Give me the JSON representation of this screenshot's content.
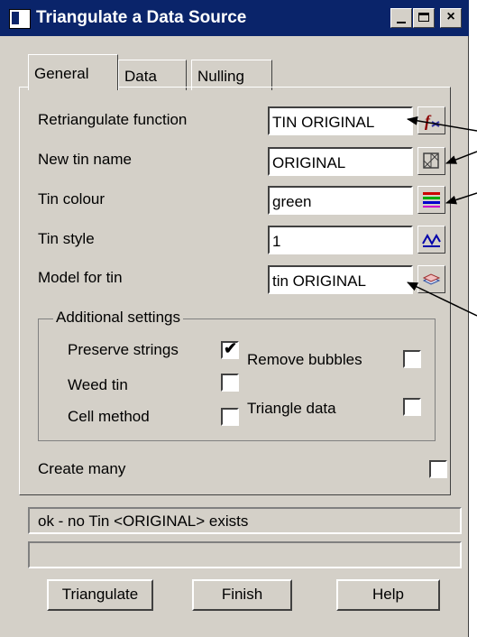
{
  "window": {
    "title": "Triangulate a Data Source"
  },
  "tabs": [
    {
      "label": "General"
    },
    {
      "label": "Data"
    },
    {
      "label": "Nulling"
    }
  ],
  "fields": {
    "retriangulate": {
      "label": "Retriangulate function",
      "value": "TIN ORIGINAL",
      "icon": "function-icon"
    },
    "tin_name": {
      "label": "New tin name",
      "value": "ORIGINAL",
      "icon": "tin-icon"
    },
    "tin_colour": {
      "label": "Tin colour",
      "value": "green",
      "icon": "colour-icon"
    },
    "tin_style": {
      "label": "Tin style",
      "value": "1",
      "icon": "style-icon"
    },
    "model": {
      "label": "Model for tin",
      "value": "tin ORIGINAL",
      "icon": "model-icon"
    }
  },
  "additional": {
    "title": "Additional settings",
    "preserve_strings": {
      "label": "Preserve strings",
      "checked": true
    },
    "remove_bubbles": {
      "label": "Remove bubbles",
      "checked": false
    },
    "weed_tin": {
      "label": "Weed tin",
      "checked": false
    },
    "triangle_data": {
      "label": "Triangle data",
      "checked": false
    },
    "cell_method": {
      "label": "Cell method",
      "checked": false
    }
  },
  "create_many": {
    "label": "Create many",
    "checked": false
  },
  "status": {
    "message": "ok - no Tin <ORIGINAL> exists",
    "message2": ""
  },
  "buttons": {
    "triangulate": "Triangulate",
    "finish": "Finish",
    "help": "Help"
  },
  "colors": {
    "titlebar": "#0a246a",
    "face": "#d4d0c8"
  }
}
